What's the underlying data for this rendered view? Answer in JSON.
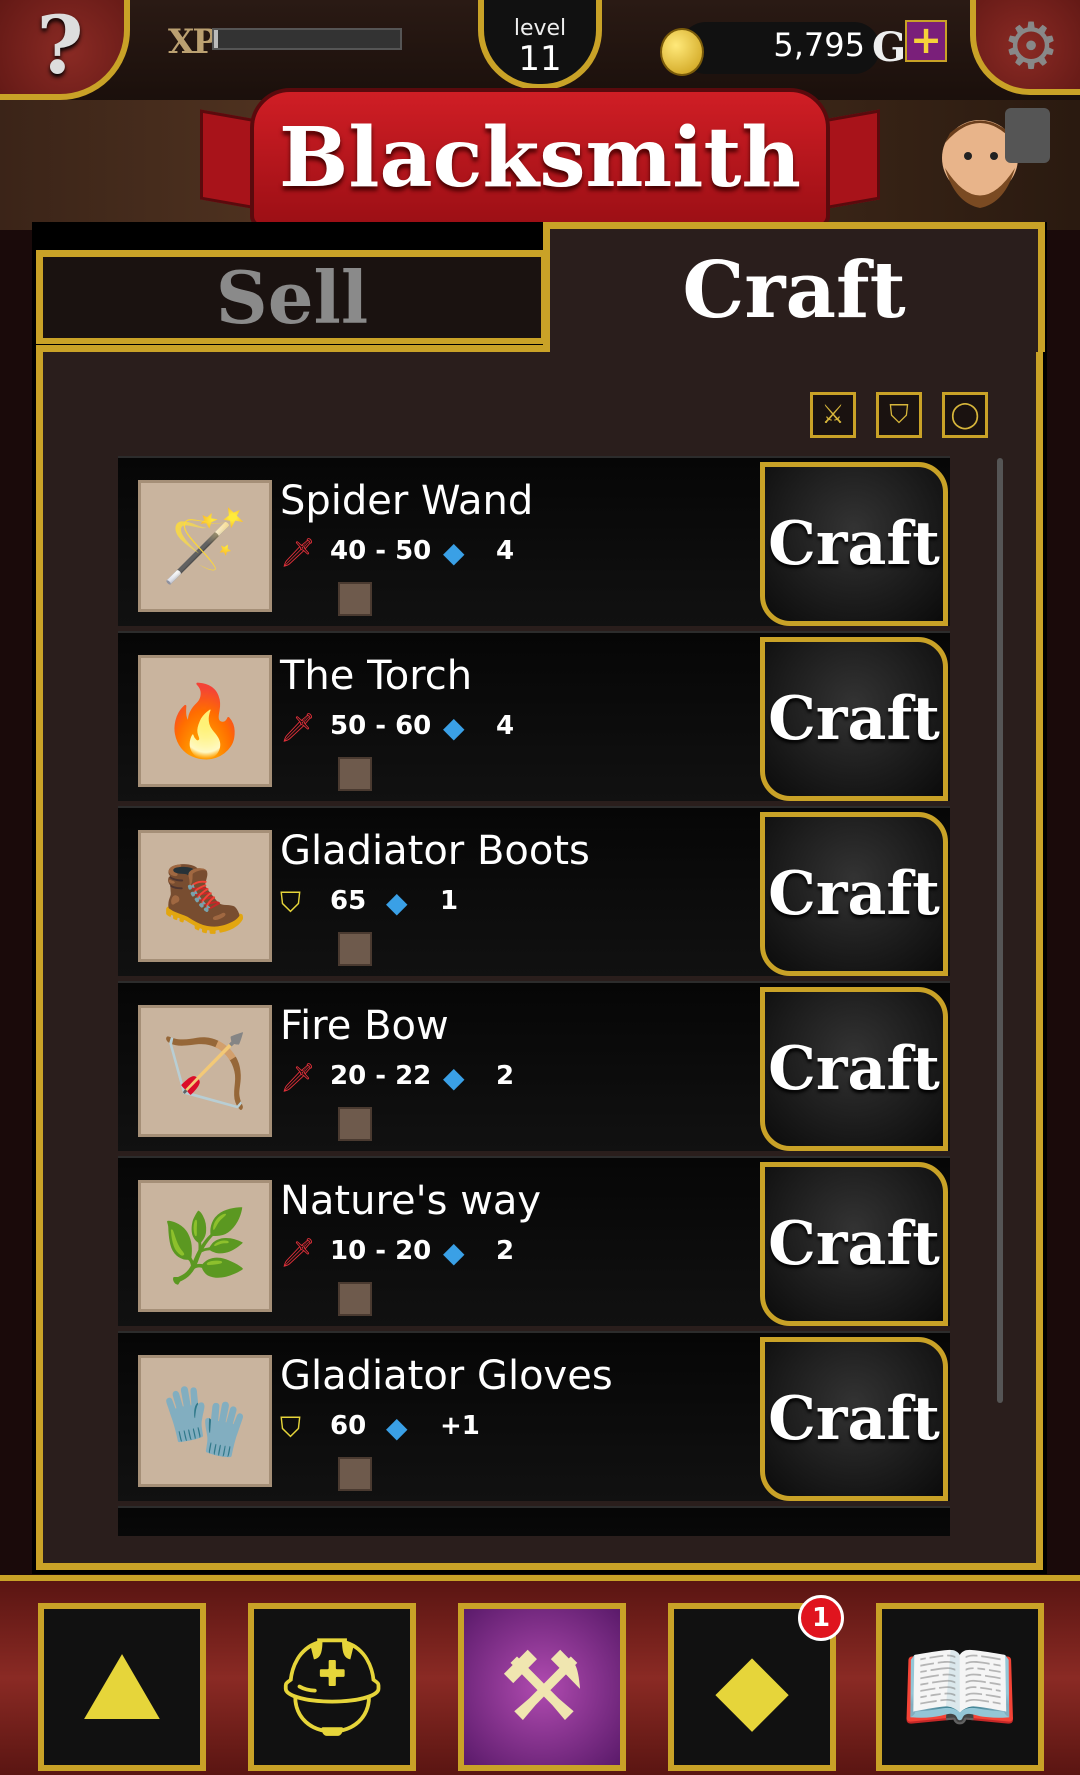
{
  "hud": {
    "help_icon": "?",
    "xp_label": "XP",
    "xp_progress": 0.02,
    "level_word": "level",
    "level_value": "11",
    "gold_amount": "5,795",
    "gold_symbol": "G",
    "add_gold": "+",
    "settings_icon": "⚙"
  },
  "title": "Blacksmith",
  "tabs": {
    "sell": "Sell",
    "craft": "Craft",
    "active": "craft"
  },
  "filters": [
    "sword-icon",
    "shield-icon",
    "ring-icon"
  ],
  "items": [
    {
      "name": "Spider Wand",
      "stat_type": "attack",
      "stat": "40 - 50",
      "gem": "4",
      "thumb": "🪄",
      "button": "Craft"
    },
    {
      "name": "The Torch",
      "stat_type": "attack",
      "stat": "50 - 60",
      "gem": "4",
      "thumb": "🔥",
      "button": "Craft"
    },
    {
      "name": "Gladiator Boots",
      "stat_type": "armor",
      "stat": "65",
      "gem": "1",
      "thumb": "🥾",
      "button": "Craft"
    },
    {
      "name": "Fire Bow",
      "stat_type": "attack",
      "stat": "20 - 22",
      "gem": "2",
      "thumb": "🏹",
      "button": "Craft"
    },
    {
      "name": "Nature's way",
      "stat_type": "attack",
      "stat": "10 - 20",
      "gem": "2",
      "thumb": "🌿",
      "button": "Craft"
    },
    {
      "name": "Gladiator Gloves",
      "stat_type": "armor",
      "stat": "60",
      "gem": "+1",
      "thumb": "🧤",
      "button": "Craft"
    }
  ],
  "bottom_nav": [
    {
      "name": "map-icon",
      "glyph": "⛰"
    },
    {
      "name": "helmet-icon",
      "glyph": "⛑"
    },
    {
      "name": "anvil-icon",
      "glyph": "⚒",
      "active": true
    },
    {
      "name": "gem-icon",
      "glyph": "◆",
      "badge": "1"
    },
    {
      "name": "book-icon",
      "glyph": "📖"
    }
  ],
  "colors": {
    "gold_border": "#c9a227",
    "ribbon": "#d01e25",
    "panel_bg": "#2a1e1c",
    "nav_active": "#b04bb0"
  }
}
